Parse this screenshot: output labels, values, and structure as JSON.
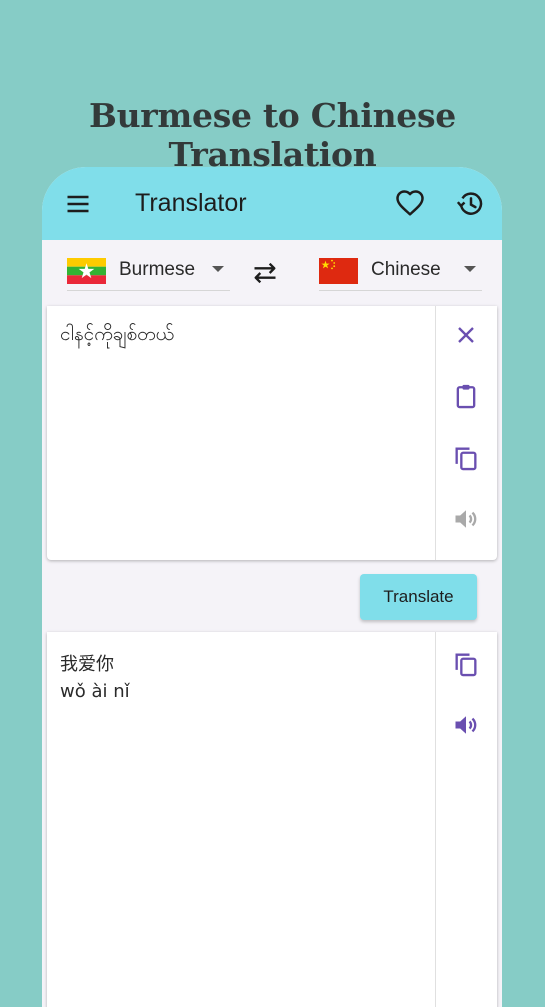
{
  "promo": {
    "title": "Burmese to Chinese Translation"
  },
  "appbar": {
    "title": "Translator",
    "icons": {
      "menu": "menu-icon",
      "favorite": "heart-outline-icon",
      "history": "history-icon"
    }
  },
  "languages": {
    "source": {
      "label": "Burmese",
      "flag": "myanmar-flag"
    },
    "target": {
      "label": "Chinese",
      "flag": "china-flag"
    },
    "swap_icon": "swap-arrows-icon"
  },
  "input": {
    "text": "ငါနင့်ကိုချစ်တယ်",
    "tools": [
      "close-icon",
      "clipboard-icon",
      "copy-icon",
      "volume-icon"
    ]
  },
  "translate_button": {
    "label": "Translate"
  },
  "output": {
    "text": "我爱你",
    "romanization": "wǒ ài nǐ",
    "tools": [
      "copy-icon",
      "volume-icon"
    ]
  },
  "colors": {
    "background": "#86ccc6",
    "accent": "#80deea",
    "icon_purple": "#6a4fb0",
    "icon_disabled": "#a9a9a9"
  }
}
